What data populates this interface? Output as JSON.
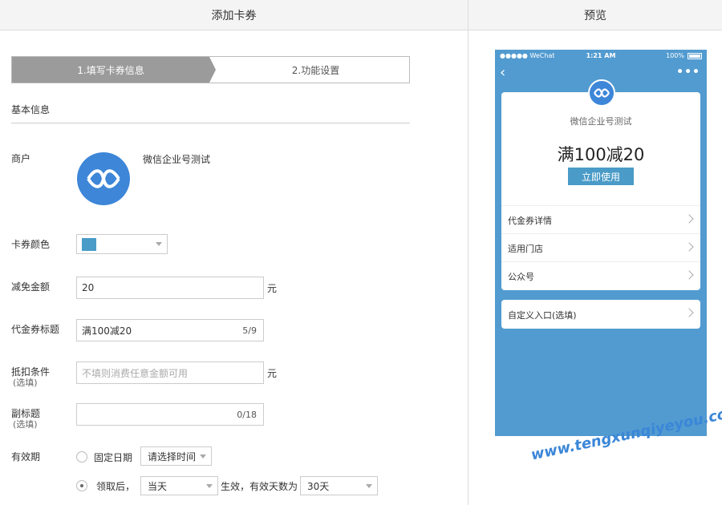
{
  "header": {
    "left_title": "添加卡券",
    "right_title": "预览"
  },
  "steps": [
    {
      "label": "1.填写卡券信息",
      "active": true
    },
    {
      "label": "2.功能设置",
      "active": false
    }
  ],
  "section": {
    "title": "基本信息"
  },
  "form": {
    "merchant_label": "商户",
    "merchant_name": "微信企业号测试",
    "merchant_logo_icon": "chat-logo-icon",
    "color_label": "卡券颜色",
    "color_value": "#4a9bc7",
    "discount_label": "减免金额",
    "discount_value": "20",
    "discount_unit": "元",
    "title_label": "代金券标题",
    "title_value": "满100减20",
    "title_count": "5/9",
    "condition_label": "抵扣条件",
    "condition_sub": "(选填)",
    "condition_placeholder": "不填则消费任意金额可用",
    "condition_unit": "元",
    "subtitle_label": "副标题",
    "subtitle_sub": "(选填)",
    "subtitle_count": "0/18",
    "validity_label": "有效期",
    "fixed_date_label": "固定日期",
    "fixed_date_select": "请选择时间",
    "after_receive_label": "领取后，",
    "after_receive_select": "当天",
    "effective_text": "生效，有效天数为",
    "days_select": "30天",
    "selected_validity": "after_receive"
  },
  "preview": {
    "status_left": "●●●●● WeChat",
    "status_time": "1:21 AM",
    "status_right": "100%",
    "merchant_name": "微信企业号测试",
    "coupon_title": "满100减20",
    "use_button": "立即使用",
    "rows": [
      "代金券详情",
      "适用门店",
      "公众号"
    ],
    "custom_entry": "自定义入口(选填)"
  },
  "watermark": "www.tengxunqiyeyou.com"
}
